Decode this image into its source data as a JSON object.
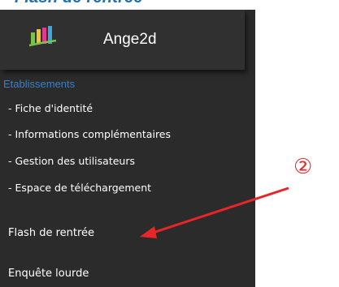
{
  "heading": "Flash de rentrée",
  "app": {
    "name": "Ange2d"
  },
  "nav": {
    "section_label": "Etablissements",
    "sub_items": [
      {
        "label": "- Fiche d'identité"
      },
      {
        "label": "- Informations complémentaires"
      },
      {
        "label": "- Gestion des utilisateurs"
      },
      {
        "label": "- Espace de téléchargement"
      }
    ],
    "main_items": [
      {
        "label": "Flash de rentrée"
      },
      {
        "label": "Enquête lourde"
      }
    ]
  },
  "annotation": {
    "step_marker": "②",
    "color": "#e8262a"
  },
  "colors": {
    "panel": "#2b2b2b",
    "header": "#303030",
    "section_accent": "#3a7fc8",
    "heading": "#1f6fb5"
  }
}
